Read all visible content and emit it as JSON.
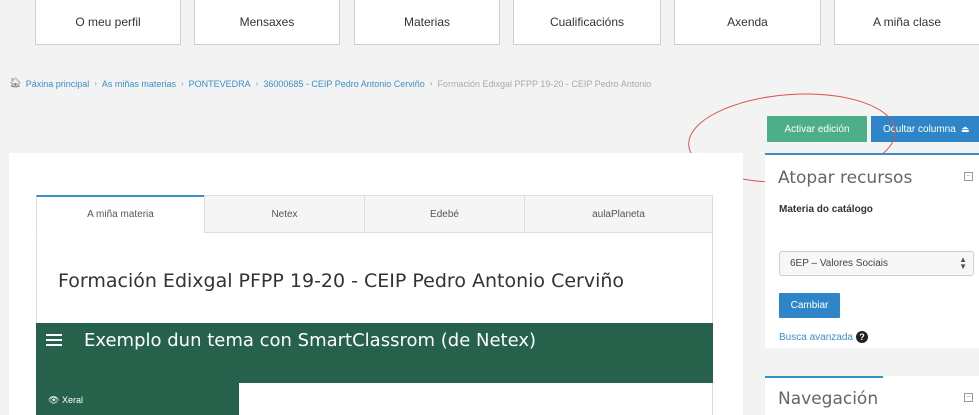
{
  "topnav": {
    "items": [
      {
        "label": "O meu perfil"
      },
      {
        "label": "Mensaxes"
      },
      {
        "label": "Materias"
      },
      {
        "label": "Cualificacións"
      },
      {
        "label": "Axenda"
      },
      {
        "label": "A miña clase"
      }
    ]
  },
  "breadcrumb": {
    "items": [
      "Páxina principal",
      "As miñas materias",
      "PONTEVEDRA",
      "36000685 - CEIP Pedro Antonio Cerviño"
    ],
    "current": "Formación Edixgal PFPP 19-20 - CEIP Pedro Antonio"
  },
  "actions": {
    "edit_label": "Activar edición",
    "hide_label": "Ocultar columna"
  },
  "tabs": [
    "A miña materia",
    "Netex",
    "Edebé",
    "aulaPlaneta"
  ],
  "course": {
    "title": "Formación Edixgal PFPP 19-20 - CEIP Pedro Antonio Cerviño"
  },
  "section": {
    "title": "Exemplo dun tema con SmartClassrom (de Netex)",
    "subtab": "Xeral"
  },
  "sidebar": {
    "resources": {
      "title": "Atopar recursos",
      "catalog_label": "Materia do catálogo",
      "selected": "6EP – Valores Sociais",
      "change_label": "Cambiar",
      "advanced_search": "Busca avanzada"
    },
    "navigation": {
      "title": "Navegación"
    }
  },
  "colors": {
    "accent": "#2e86c9",
    "edit_button": "#4caf88",
    "section_bar": "#26614b",
    "highlight_oval": "#d9534f"
  }
}
